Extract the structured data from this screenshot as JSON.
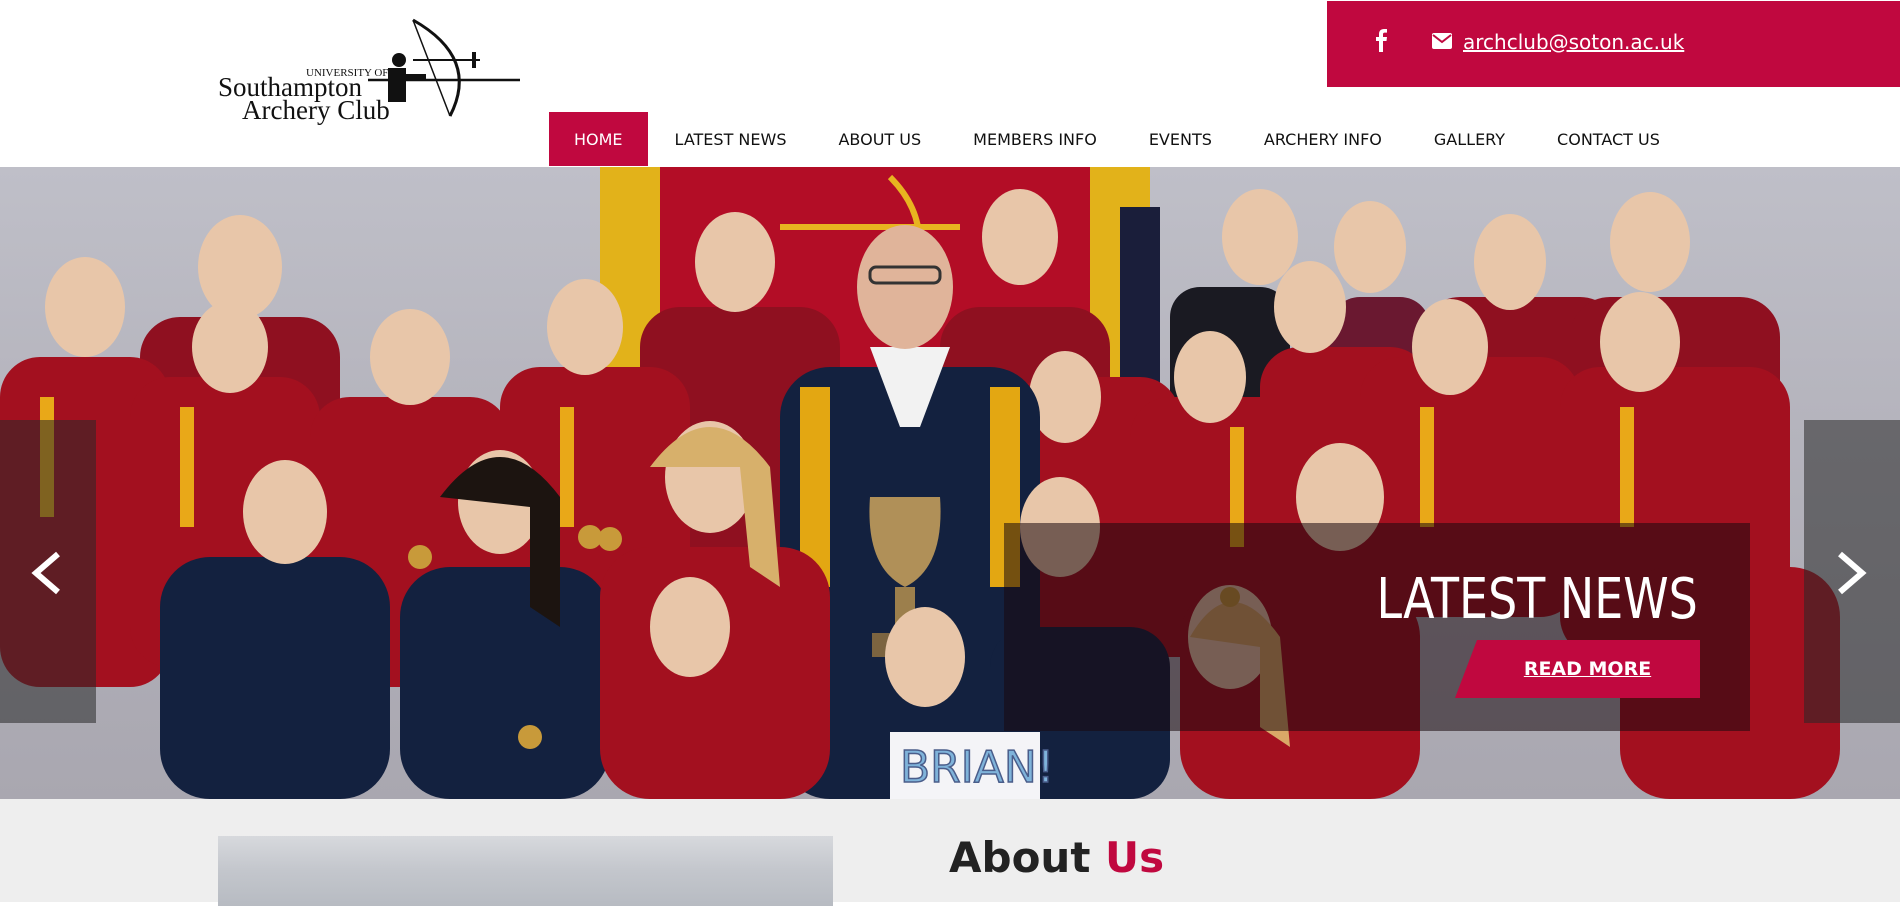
{
  "header": {
    "logo": {
      "line1": "UNIVERSITY OF",
      "line2": "Southampton",
      "line3": "Archery Club"
    },
    "contact": {
      "facebook_icon": "facebook-icon",
      "mail_icon": "envelope-icon",
      "email": "archclub@soton.ac.uk"
    },
    "nav": [
      {
        "label": "HOME",
        "active": true
      },
      {
        "label": "LATEST NEWS"
      },
      {
        "label": "ABOUT US"
      },
      {
        "label": "MEMBERS INFO"
      },
      {
        "label": "EVENTS"
      },
      {
        "label": "ARCHERY INFO"
      },
      {
        "label": "GALLERY"
      },
      {
        "label": "CONTACT US"
      }
    ]
  },
  "hero": {
    "prev_icon": "chevron-left-icon",
    "next_icon": "chevron-right-icon",
    "caption_title": "LATEST NEWS",
    "cta_label": "READ MORE",
    "sign_text": "BRIAN!"
  },
  "about": {
    "heading_part1": "About",
    "heading_part2": "Us"
  },
  "colors": {
    "brand": "#c0083f",
    "shirt_red": "#8f1020",
    "shirt_gold": "#e3a712",
    "navy": "#13213f"
  }
}
